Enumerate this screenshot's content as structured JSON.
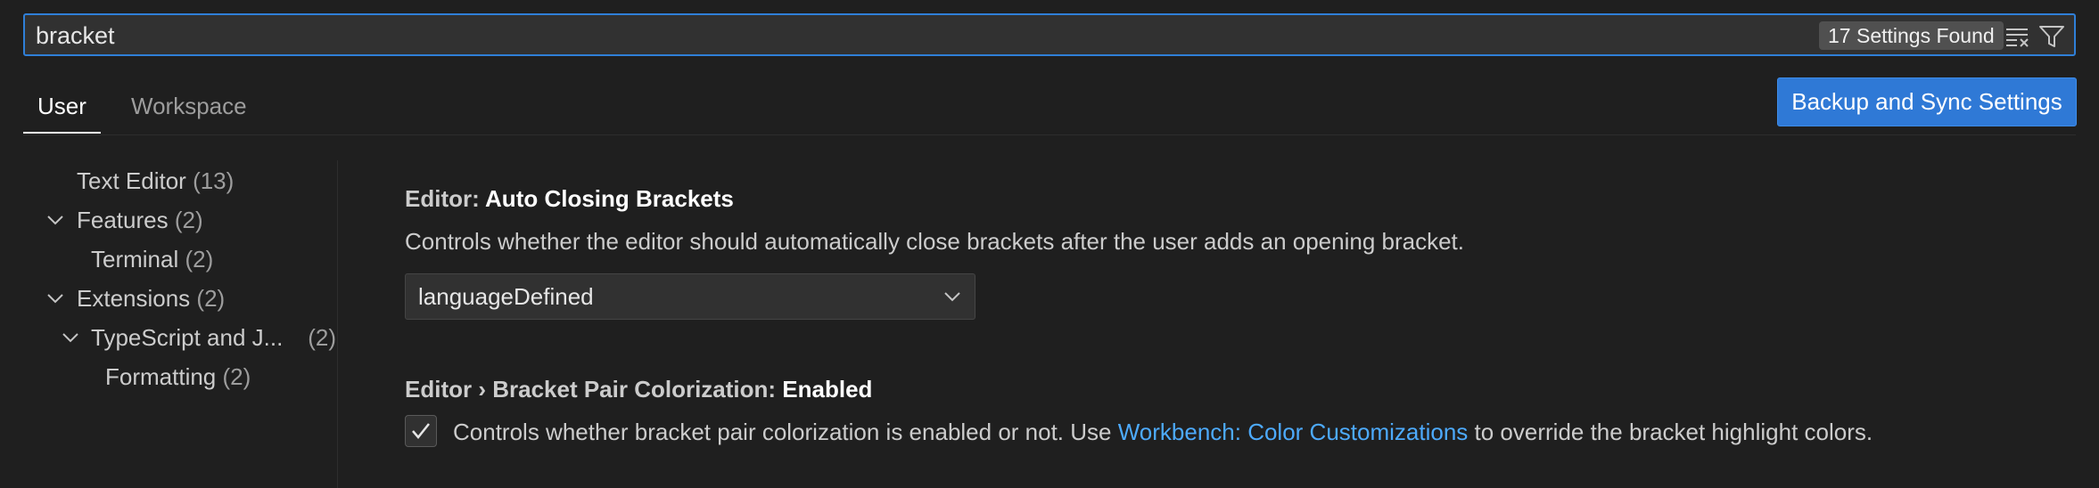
{
  "search": {
    "value": "bracket",
    "results_badge": "17 Settings Found",
    "clear_icon": "clear-filter-icon",
    "filter_icon": "filter-icon"
  },
  "tabs": [
    {
      "label": "User",
      "active": true
    },
    {
      "label": "Workspace",
      "active": false
    }
  ],
  "sync_button": "Backup and Sync Settings",
  "toc": [
    {
      "label": "Text Editor",
      "count": "(13)",
      "expanded": null
    },
    {
      "label": "Features",
      "count": "(2)",
      "expanded": true
    },
    {
      "label": "Terminal",
      "count": "(2)",
      "expanded": null
    },
    {
      "label": "Extensions",
      "count": "(2)",
      "expanded": true
    },
    {
      "label": "TypeScript and J...",
      "count": "(2)",
      "expanded": true
    },
    {
      "label": "Formatting",
      "count": "(2)",
      "expanded": null
    }
  ],
  "settings": [
    {
      "category": "Editor: ",
      "name": "Auto Closing Brackets",
      "description": "Controls whether the editor should automatically close brackets after the user adds an opening bracket.",
      "control": "select",
      "value": "languageDefined"
    },
    {
      "category": "Editor › Bracket Pair Colorization: ",
      "name": "Enabled",
      "description_before": "Controls whether bracket pair colorization is enabled or not. Use ",
      "link": "Workbench: Color Customizations",
      "description_after": " to override the bracket highlight colors.",
      "control": "checkbox",
      "checked": true
    }
  ],
  "colors": {
    "accent": "#2f79d6",
    "link": "#4daafc",
    "background": "#1f1f1f"
  }
}
